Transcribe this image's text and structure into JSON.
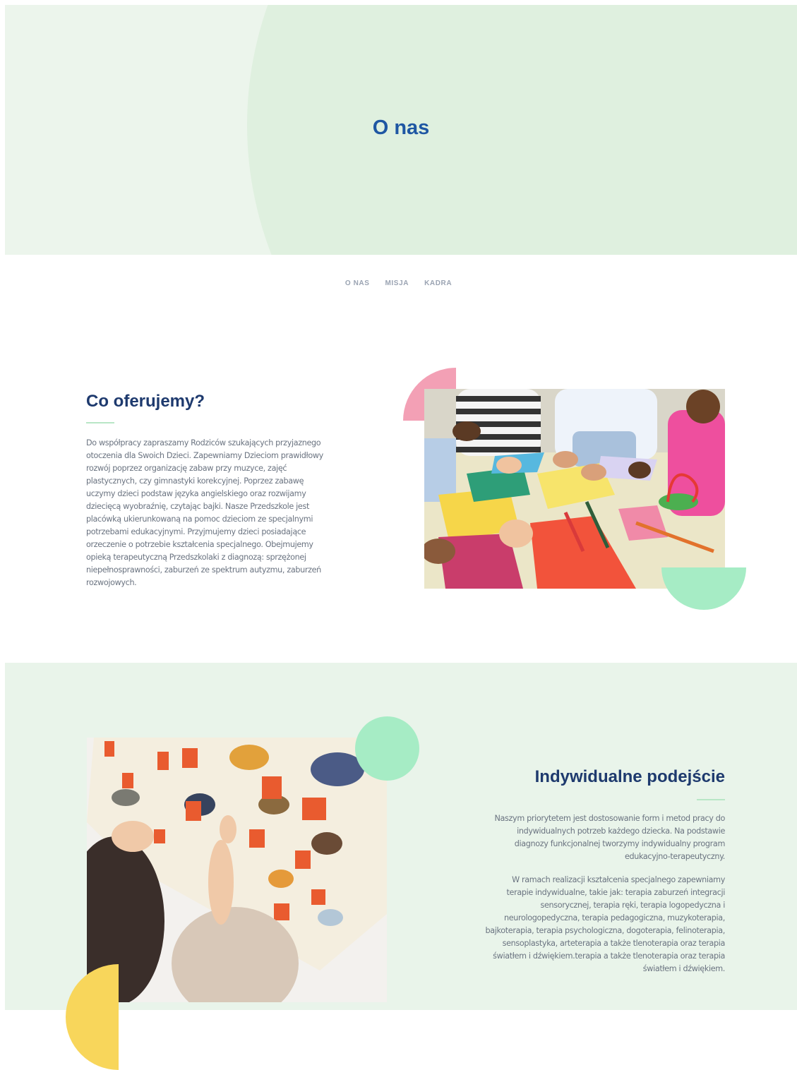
{
  "hero": {
    "title": "O nas"
  },
  "subnav": {
    "items": [
      "O NAS",
      "MISJA",
      "KADRA"
    ]
  },
  "offer": {
    "title": "Co oferujemy?",
    "text": "Do współpracy zapraszamy Rodziców szukających przyjaznego otoczenia dla Swoich Dzieci. Zapewniamy Dzieciom prawidłowy rozwój poprzez organizację zabaw przy muzyce, zajęć plastycznych, czy gimnastyki korekcyjnej. Poprzez zabawę uczymy dzieci podstaw języka angielskiego oraz rozwijamy dziecięcą wyobraźnię, czytając bajki. Nasze Przedszkole jest placówką ukierunkowaną na pomoc dzieciom ze specjalnymi potrzebami edukacyjnymi. Przyjmujemy dzieci posiadające orzeczenie o potrzebie kształcenia specjalnego. Obejmujemy opieką terapeutyczną Przedszkolaki z diagnozą: sprzężonej niepełnosprawności, zaburzeń ze spektrum autyzmu, zaburzeń rozwojowych."
  },
  "individual": {
    "title": "Indywidualne podejście",
    "paragraph1": "Naszym priorytetem jest dostosowanie form i metod pracy do indywidualnych potrzeb każdego dziecka. Na podstawie diagnozy funkcjonalnej tworzymy indywidualny program edukacyjno-terapeutyczny.",
    "paragraph2": "W ramach realizacji kształcenia specjalnego zapewniamy terapie indywidualne, takie jak: terapia zaburzeń integracji sensorycznej, terapia ręki, terapia logopedyczna i neurologopedyczna, terapia pedagogiczna, muzykoterapia, bajkoterapia, terapia psychologiczna, dogoterapia, felinoterapia, sensoplastyka, arteterapia a także tlenoterapia oraz terapia światłem i dźwiękiem.terapia a także tlenoterapia oraz terapia światłem i dźwiękiem."
  },
  "colors": {
    "hero_bg": "#ecf5ec",
    "hero_curve": "#dff0df",
    "title_blue": "#1f57a3",
    "heading_navy": "#1e3a6e",
    "pink": "#f3a0b5",
    "mint": "#a6ecc5",
    "yellow": "#f8d65b",
    "section_bg": "#e9f4ea"
  }
}
